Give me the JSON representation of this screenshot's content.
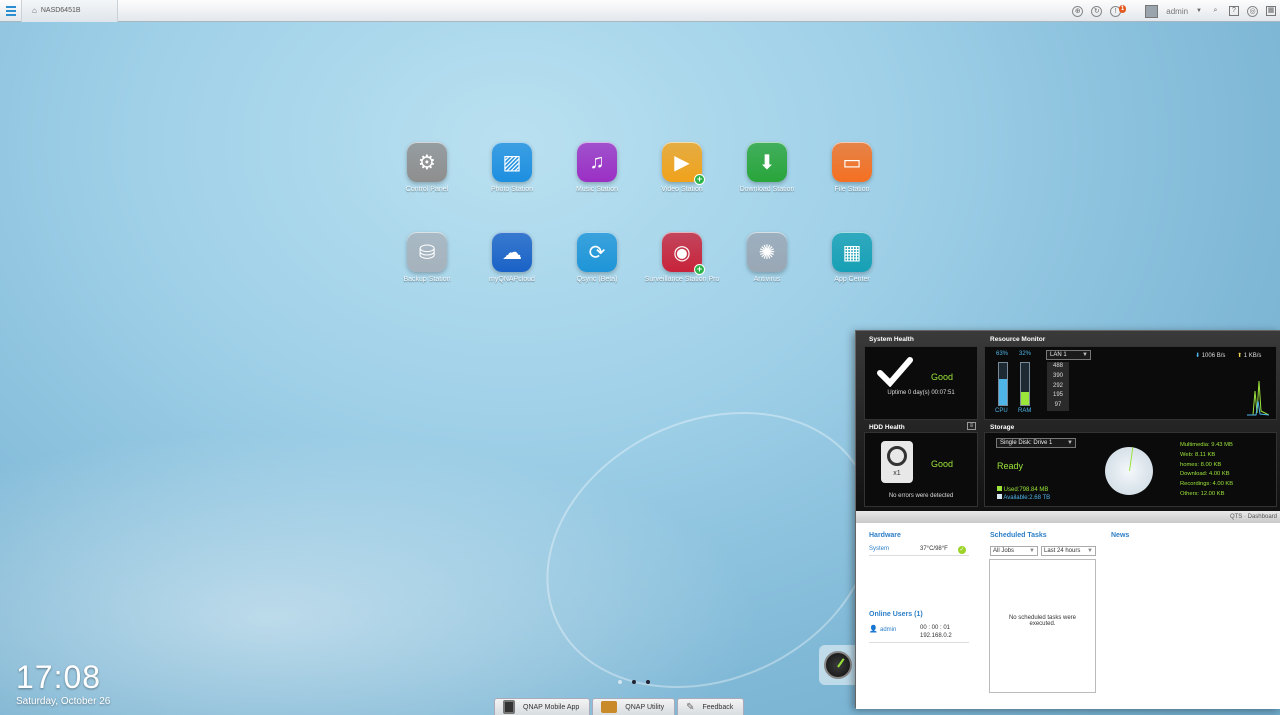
{
  "topbar": {
    "host": "NASD6451B",
    "user": "admin",
    "notif_count": "1"
  },
  "apps": [
    {
      "label": "Control Panel",
      "color": "#8e8e8e",
      "icon": "gear-icon"
    },
    {
      "label": "Photo Station",
      "color": "#1d8fe0",
      "icon": "photo-icon"
    },
    {
      "label": "Music Station",
      "color": "#9b2fc4",
      "icon": "music-icon"
    },
    {
      "label": "Video Station",
      "color": "#f1a21a",
      "icon": "play-icon"
    },
    {
      "label": "Download Station",
      "color": "#29a53a",
      "icon": "download-icon"
    },
    {
      "label": "File Station",
      "color": "#f57022",
      "icon": "folder-icon"
    },
    {
      "label": "Backup Station",
      "color": "#a6b2bc",
      "icon": "backup-icon"
    },
    {
      "label": "myQNAPcloud",
      "color": "#1a62c7",
      "icon": "cloud-icon"
    },
    {
      "label": "Qsync (Beta)",
      "color": "#1e95d8",
      "icon": "sync-icon"
    },
    {
      "label": "Surveillance Station Pro",
      "color": "#c8233a",
      "icon": "camera-icon"
    },
    {
      "label": "Antivirus",
      "color": "#9aa7b5",
      "icon": "antivirus-icon"
    },
    {
      "label": "App Center",
      "color": "#16a0b5",
      "icon": "grid-icon"
    }
  ],
  "clock": {
    "time": "17:08",
    "date": "Saturday, October 26"
  },
  "bottom": {
    "mobile": "QNAP Mobile App",
    "utility": "QNAP Utility",
    "feedback": "Feedback"
  },
  "dashboard": {
    "system_health": {
      "title": "System Health",
      "status": "Good",
      "uptime": "Uptime 0 day(s) 00:07:51"
    },
    "resource": {
      "title": "Resource Monitor",
      "cpu_pct": "63%",
      "ram_pct": "32%",
      "cpu_label": "CPU",
      "ram_label": "RAM",
      "cpu_level": 0.63,
      "ram_level": 0.32,
      "lan": "LAN 1",
      "scale": [
        "488",
        "390",
        "292",
        "195",
        "97"
      ],
      "down": "1006 B/s",
      "up": "1 KB/s"
    },
    "hdd": {
      "title": "HDD Health",
      "status": "Good",
      "count": "x1",
      "note": "No errors were detected"
    },
    "storage": {
      "title": "Storage",
      "select": "Single Disk: Drive  1",
      "status": "Ready",
      "used": "Used:798.84 MB",
      "available": "Available:2.68 TB",
      "legend": [
        "Multimedia: 9.43 MB",
        "Web: 8.11 KB",
        "homes: 8.00 KB",
        "Download: 4.00 KB",
        "Recordings: 4.00 KB",
        "Others: 12.00 KB"
      ]
    },
    "strip": "QTS · Dashboard",
    "hardware": {
      "title": "Hardware",
      "system_label": "System",
      "temp": "37°C/98°F"
    },
    "online": {
      "title": "Online Users (1)",
      "user": "admin",
      "time": "00 : 00 : 01",
      "ip": "192.168.0.2"
    },
    "tasks": {
      "title": "Scheduled Tasks",
      "filter1": "All Jobs",
      "filter2": "Last 24 hours",
      "empty": "No scheduled tasks were executed."
    },
    "news": {
      "title": "News"
    }
  }
}
